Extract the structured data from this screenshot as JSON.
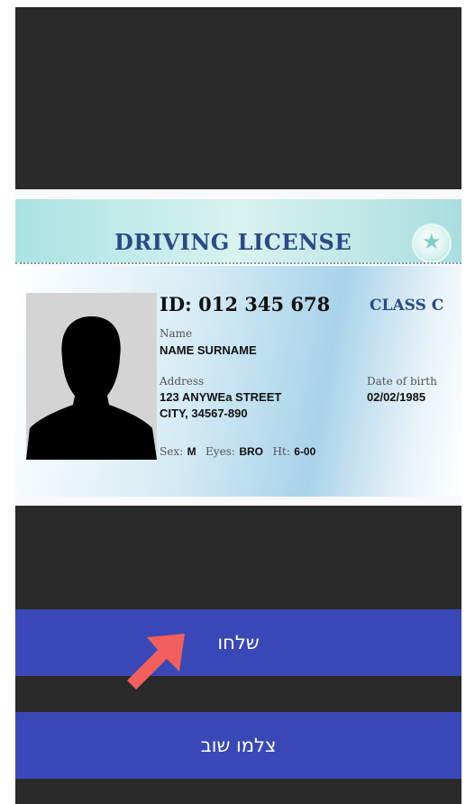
{
  "license": {
    "title": "DRIVING LICENSE",
    "id_text": "ID: 012 345 678",
    "class_text": "CLASS C",
    "name_label": "Name",
    "name_value": "NAME SURNAME",
    "address_label": "Address",
    "address_line1": "123 ANYWEa STREET",
    "address_line2": "CITY, 34567-890",
    "dob_label": "Date of birth",
    "dob_value": "02/02/1985",
    "sex_label": "Sex:",
    "sex_value": "M",
    "eyes_label": "Eyes:",
    "eyes_value": "BRO",
    "height_label": "Ht:",
    "height_value": "6-00",
    "seal_icon": "star-seal-icon"
  },
  "buttons": {
    "send_label": "שלחו",
    "retake_label": "צלמו שוב"
  },
  "colors": {
    "screen_bg": "#2a2a2a",
    "button_bg": "#3a48b7",
    "arrow": "#f25f5c",
    "title_blue": "#2a4a86"
  }
}
